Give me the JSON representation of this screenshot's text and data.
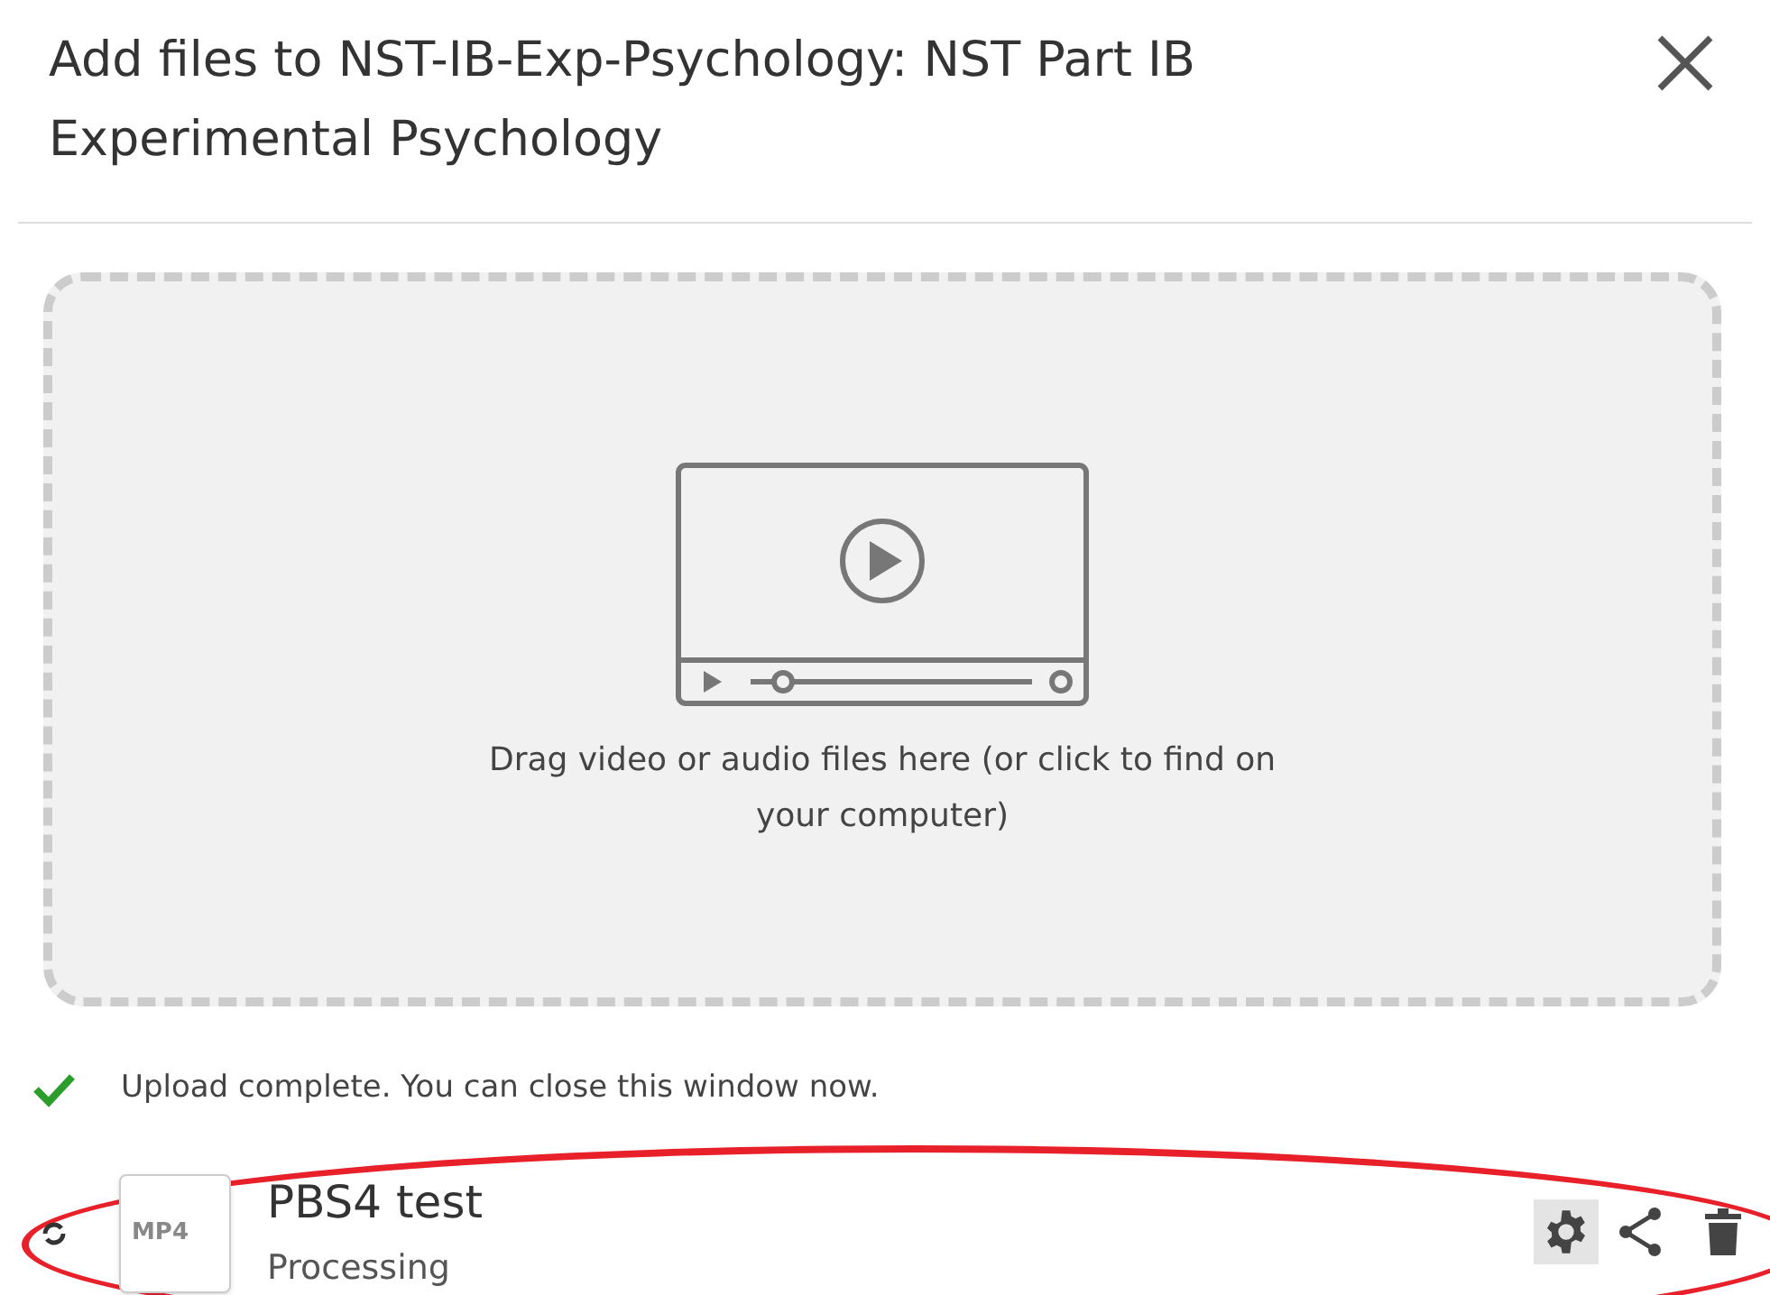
{
  "dialog": {
    "title": "Add files to NST-IB-Exp-Psychology: NST Part IB Experimental Psychology"
  },
  "drop_zone": {
    "hint": "Drag video or audio files here (or click to find on your computer)"
  },
  "status": {
    "message": "Upload complete. You can close this window now."
  },
  "files": [
    {
      "name": "PBS4 test",
      "type_label": "MP4",
      "state": "Processing",
      "highlighted": true
    }
  ]
}
